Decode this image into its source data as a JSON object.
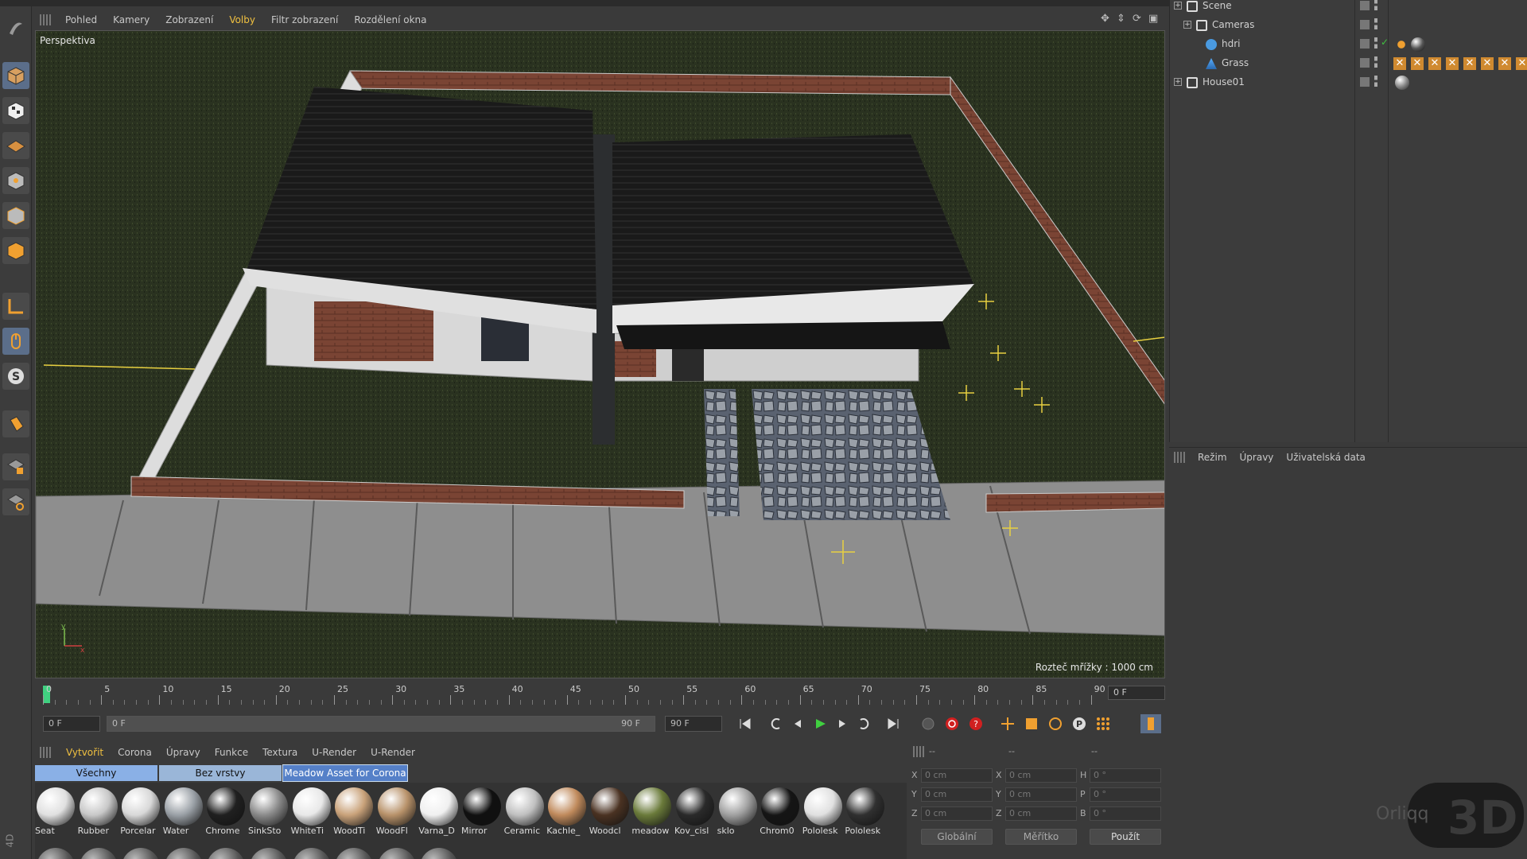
{
  "viewport_menu": [
    "Pohled",
    "Kamery",
    "Zobrazení",
    "Volby",
    "Filtr zobrazení",
    "Rozdělení okna"
  ],
  "viewport_menu_active": "Volby",
  "viewport": {
    "label": "Perspektiva",
    "grid_spacing": "Rozteč mřížky : 1000 cm"
  },
  "timeline": {
    "ticks": [
      "0",
      "5",
      "10",
      "15",
      "20",
      "25",
      "30",
      "35",
      "40",
      "45",
      "50",
      "55",
      "60",
      "65",
      "70",
      "75",
      "80",
      "85",
      "90"
    ],
    "current_frame": "0 F",
    "start_frame": "0 F",
    "range_start": "0 F",
    "range_end": "90 F",
    "end_frame": "90 F"
  },
  "material_menu": [
    "Vytvořit",
    "Corona",
    "Úpravy",
    "Funkce",
    "Textura",
    "U-Render",
    "U-Render"
  ],
  "material_menu_active": "Vytvořit",
  "material_tabs": [
    "Všechny",
    "Bez vrstvy",
    "Meadow Asset for Corona"
  ],
  "materials": [
    {
      "name": "Seat",
      "color": "#e0e0e0"
    },
    {
      "name": "Rubber",
      "color": "#c8c8c8"
    },
    {
      "name": "Porcelar",
      "color": "#d8d8d8"
    },
    {
      "name": "Water",
      "color": "#9aa0a6"
    },
    {
      "name": "Chrome",
      "color": "#202020"
    },
    {
      "name": "SinkSto",
      "color": "#8a8a8a"
    },
    {
      "name": "WhiteTi",
      "color": "#e8e8e8"
    },
    {
      "name": "WoodTi",
      "color": "#c9a27a"
    },
    {
      "name": "WoodFl",
      "color": "#b8926a"
    },
    {
      "name": "Varna_D",
      "color": "#f0f0f0"
    },
    {
      "name": "Mirror",
      "color": "#101010"
    },
    {
      "name": "Ceramic",
      "color": "#c0c0c0"
    },
    {
      "name": "Kachle_",
      "color": "#c08a5c"
    },
    {
      "name": "Woodcl",
      "color": "#4a3222"
    },
    {
      "name": "meadow",
      "color": "#6a7a3a"
    },
    {
      "name": "Kov_cisl",
      "color": "#2a2a2a"
    },
    {
      "name": "sklo",
      "color": "#a0a0a0"
    },
    {
      "name": "Chrom0",
      "color": "#151515"
    },
    {
      "name": "Pololesk",
      "color": "#e0e0e0"
    },
    {
      "name": "Pololesk",
      "color": "#303030"
    }
  ],
  "coords": {
    "headers": [
      "--",
      "--",
      "--"
    ],
    "rows": [
      {
        "a": "X",
        "av": "0 cm",
        "b": "X",
        "bv": "0 cm",
        "c": "H",
        "cv": "0 °"
      },
      {
        "a": "Y",
        "av": "0 cm",
        "b": "Y",
        "bv": "0 cm",
        "c": "P",
        "cv": "0 °"
      },
      {
        "a": "Z",
        "av": "0 cm",
        "b": "Z",
        "bv": "0 cm",
        "c": "B",
        "cv": "0 °"
      }
    ],
    "mode1": "Globální",
    "mode2": "Měřítko",
    "apply": "Použít"
  },
  "objects": [
    {
      "name": "Scene",
      "level": 0,
      "icon": "null-icon"
    },
    {
      "name": "Cameras",
      "level": 1,
      "icon": "null-icon"
    },
    {
      "name": "hdri",
      "level": 2,
      "icon": "sky-icon"
    },
    {
      "name": "Grass",
      "level": 2,
      "icon": "grass-icon"
    },
    {
      "name": "House01",
      "level": 0,
      "icon": "null-icon"
    }
  ],
  "attributes_menu": [
    "Režim",
    "Úpravy",
    "Uživatelská data"
  ],
  "watermark": {
    "text1": "Orliqq",
    "text2": "3D"
  },
  "corner_label": "4D"
}
